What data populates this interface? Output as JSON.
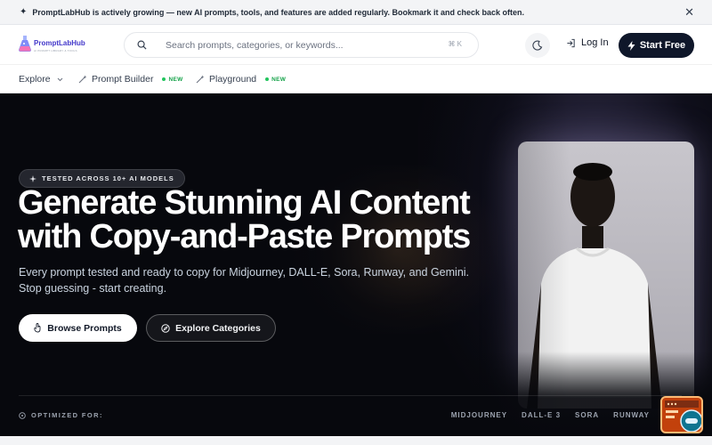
{
  "announcement": {
    "text": "PromptLabHub is actively growing — new AI prompts, tools, and features are added regularly. Bookmark it and check back often.",
    "close_icon": "close-icon"
  },
  "header": {
    "logo_name": "PromptLabHub",
    "logo_tagline": "AI PROMPT LIBRARY & TOOLS",
    "search_placeholder": "Search prompts, categories, or keywords...",
    "search_shortcut": "⌘ K",
    "login_label": "Log In",
    "start_label": "Start Free"
  },
  "subnav": {
    "explore_label": "Explore",
    "prompt_builder_label": "Prompt Builder",
    "prompt_builder_badge": "NEW",
    "playground_label": "Playground",
    "playground_badge": "NEW"
  },
  "hero": {
    "tested_pill": "TESTED ACROSS 10+ AI MODELS",
    "title_line1": "Generate Stunning AI Content",
    "title_line2": "with Copy-and-Paste Prompts",
    "subtitle_line1": "Every prompt tested and ready to copy for Midjourney, DALL-E, Sora, Runway, and Gemini.",
    "subtitle_line2": "Stop guessing - start creating.",
    "browse_label": "Browse Prompts",
    "explore_label": "Explore Categories",
    "optimized_label": "OPTIMIZED FOR:",
    "models": [
      "MIDJOURNEY",
      "DALL-E 3",
      "SORA",
      "RUNWAY"
    ]
  },
  "colors": {
    "accent_dark": "#0f172a",
    "hero_bg": "#07080d",
    "new_badge": "#16a34a",
    "logo": "#4338ca"
  }
}
